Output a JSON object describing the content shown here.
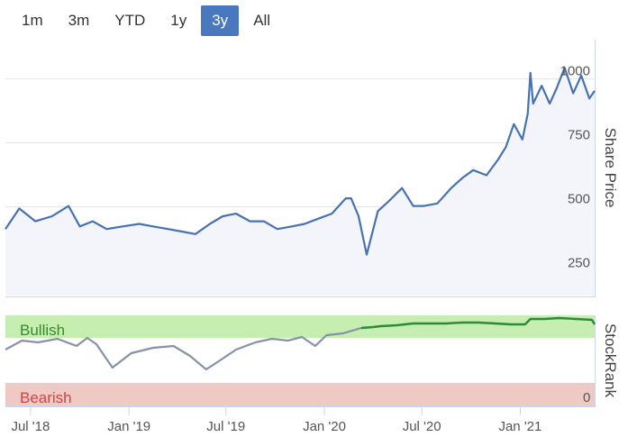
{
  "range_selector": {
    "buttons": [
      {
        "label": "1m"
      },
      {
        "label": "3m"
      },
      {
        "label": "YTD"
      },
      {
        "label": "1y"
      },
      {
        "label": "3y"
      },
      {
        "label": "All"
      }
    ],
    "selected": "3y"
  },
  "colors": {
    "price_line": "#4672b4",
    "price_fill": "#f4f5fb",
    "bullish_band": "#c6eeb0",
    "bearish_band": "#efc9c4",
    "rank_bullish_line": "#2b8a3c",
    "rank_neutral_line": "#8592a8",
    "selected_button": "#4a78be"
  },
  "chart_data": [
    {
      "type": "line",
      "ylabel": "Share Price",
      "yticks": [
        "250",
        "500",
        "750",
        "1000"
      ],
      "ylim": [
        150,
        1150
      ],
      "xlim": [
        "2018-05-15",
        "2021-05-20"
      ],
      "grid": true,
      "series": [
        {
          "x": [
            "2018-05-15",
            "2018-06-10",
            "2018-07-10",
            "2018-08-10",
            "2018-09-10",
            "2018-10-01",
            "2018-10-25",
            "2018-11-20",
            "2018-12-20",
            "2019-01-20",
            "2019-02-15",
            "2019-03-15",
            "2019-04-10",
            "2019-05-05",
            "2019-06-01",
            "2019-06-25",
            "2019-07-20",
            "2019-08-15",
            "2019-09-10",
            "2019-10-05",
            "2019-11-01",
            "2019-11-25",
            "2019-12-20",
            "2020-01-15",
            "2020-02-10",
            "2020-02-20",
            "2020-03-05",
            "2020-03-20",
            "2020-03-25",
            "2020-04-10",
            "2020-05-01",
            "2020-05-25",
            "2020-06-15",
            "2020-07-05",
            "2020-07-30",
            "2020-08-25",
            "2020-09-15",
            "2020-10-05",
            "2020-10-30",
            "2020-11-20",
            "2020-12-05",
            "2020-12-20",
            "2021-01-05",
            "2021-01-15",
            "2021-01-20",
            "2021-01-25",
            "2021-02-10",
            "2021-02-25",
            "2021-03-10",
            "2021-03-25",
            "2021-04-10",
            "2021-04-25",
            "2021-05-10",
            "2021-05-20"
          ],
          "y": [
            410,
            490,
            440,
            460,
            500,
            420,
            440,
            410,
            420,
            430,
            420,
            410,
            400,
            390,
            430,
            460,
            470,
            440,
            440,
            410,
            420,
            430,
            450,
            470,
            530,
            530,
            460,
            310,
            350,
            480,
            520,
            570,
            500,
            500,
            510,
            570,
            610,
            640,
            620,
            680,
            730,
            820,
            760,
            860,
            1020,
            900,
            970,
            900,
            960,
            1040,
            940,
            1010,
            920,
            950
          ]
        }
      ]
    },
    {
      "type": "line",
      "ylabel": "StockRank",
      "band_labels": {
        "top": "Bullish",
        "bottom": "Bearish"
      },
      "yticks": [
        "0"
      ],
      "ylim": [
        0,
        100
      ],
      "xticks": [
        "Jul '18",
        "Jan '19",
        "Jul '19",
        "Jan '20",
        "Jul '20",
        "Jan '21"
      ],
      "series": [
        {
          "x": [
            "2018-05-15",
            "2018-06-15",
            "2018-07-15",
            "2018-08-20",
            "2018-09-25",
            "2018-10-15",
            "2018-11-01",
            "2018-12-01",
            "2019-01-05",
            "2019-02-15",
            "2019-03-25",
            "2019-04-25",
            "2019-05-25",
            "2019-06-20",
            "2019-07-20",
            "2019-08-25",
            "2019-09-25",
            "2019-10-25",
            "2019-11-20",
            "2019-12-15",
            "2020-01-05",
            "2020-02-05",
            "2020-03-10",
            "2020-04-01",
            "2020-04-15",
            "2020-05-15",
            "2020-06-15",
            "2020-07-15",
            "2020-08-15",
            "2020-09-15",
            "2020-10-15",
            "2020-11-15",
            "2020-12-15",
            "2021-01-10",
            "2021-01-20",
            "2021-02-15",
            "2021-03-15",
            "2021-04-15",
            "2021-05-15",
            "2021-05-20"
          ],
          "y": [
            62,
            72,
            70,
            74,
            66,
            75,
            68,
            42,
            58,
            64,
            66,
            55,
            40,
            50,
            62,
            70,
            74,
            72,
            76,
            66,
            78,
            80,
            86,
            87,
            88,
            89,
            91,
            91,
            91,
            92,
            92,
            91,
            90,
            90,
            96,
            96,
            97,
            96,
            95,
            90
          ]
        }
      ]
    }
  ]
}
